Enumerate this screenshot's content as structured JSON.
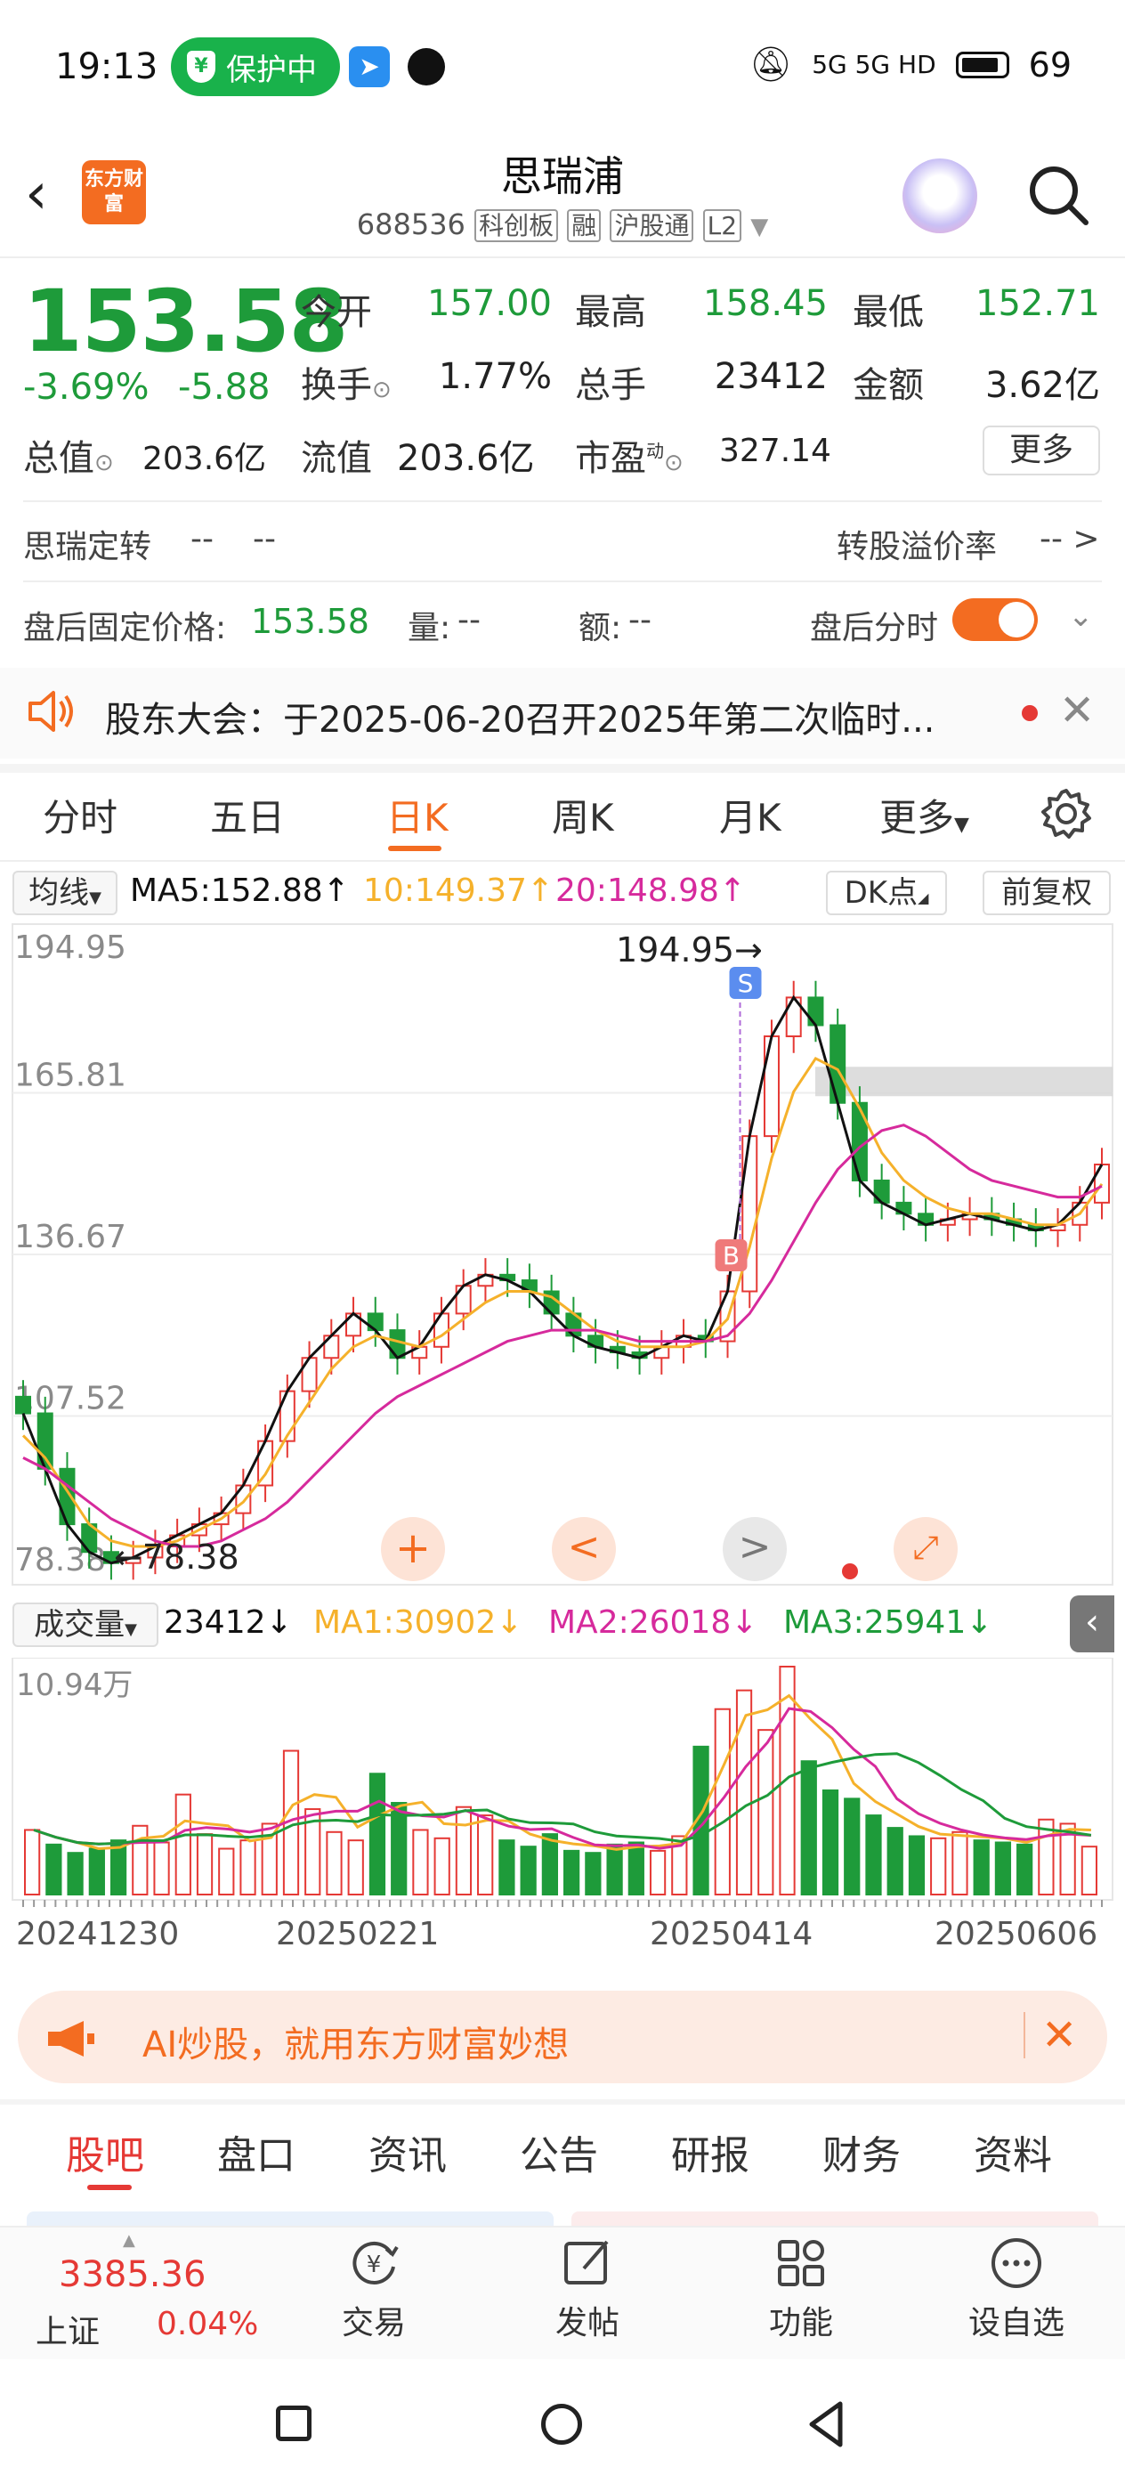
{
  "status_bar": {
    "time": "19:13",
    "protect_label": "保护中",
    "battery": "69",
    "network": "5G 5G HD"
  },
  "header": {
    "logo": "东方财富",
    "title": "思瑞浦",
    "code": "688536",
    "tags": [
      "科创板",
      "融",
      "沪股通",
      "L2"
    ]
  },
  "quote": {
    "price": "153.58",
    "change_pct": "-3.69%",
    "change_abs": "-5.88",
    "open_label": "今开",
    "open": "157.00",
    "high_label": "最高",
    "high": "158.45",
    "low_label": "最低",
    "low": "152.71",
    "turnover_label": "换手",
    "turnover": "1.77%",
    "volume_label": "总手",
    "volume": "23412",
    "amount_label": "金额",
    "amount": "3.62亿",
    "mktcap_label": "总值",
    "mktcap": "203.6亿",
    "float_label": "流值",
    "float": "203.6亿",
    "pe_label": "市盈",
    "pe_sup": "动",
    "pe": "327.14",
    "more": "更多"
  },
  "convertible": {
    "name": "思瑞定转",
    "v1": "--",
    "v2": "--",
    "premium_label": "转股溢价率",
    "premium": "-- >"
  },
  "after_hours": {
    "fixed_label": "盘后固定价格:",
    "fixed": "153.58",
    "vol_label": "量:",
    "vol": "--",
    "amt_label": "额:",
    "amt": "--",
    "timeshare_label": "盘后分时"
  },
  "notice": {
    "text": "股东大会：于2025-06-20召开2025年第二次临时..."
  },
  "period_tabs": [
    "分时",
    "五日",
    "日K",
    "周K",
    "月K",
    "更多"
  ],
  "ma": {
    "select": "均线",
    "ma5": "MA5:152.88↑",
    "ma10": "10:149.37↑",
    "ma20": "20:148.98↑",
    "dk": "DK点",
    "adjust": "前复权"
  },
  "colors": {
    "up": "#e53935",
    "down": "#1e9b3a",
    "ma5": "#111111",
    "ma10": "#f5b12b",
    "ma20": "#d62a9c",
    "accent": "#f36c21"
  },
  "chart_data": [
    {
      "type": "candlestick",
      "y_axis_ticks": [
        "194.95",
        "165.81",
        "136.67",
        "107.52",
        "78.38"
      ],
      "ylim": [
        78.38,
        194.95
      ],
      "max_label": "194.95→",
      "min_label": "←78.38",
      "x_ticks": [
        "20241230",
        "20250221",
        "20250414",
        "20250606"
      ],
      "series": [
        {
          "name": "MA5",
          "values": [
            108,
            98,
            88,
            83,
            81,
            82,
            84,
            86,
            88,
            90,
            95,
            103,
            112,
            118,
            122,
            126,
            123,
            118,
            120,
            126,
            131,
            133,
            132,
            130,
            126,
            122,
            120,
            119,
            118,
            120,
            122,
            121,
            130,
            158,
            176,
            183,
            178,
            164,
            150,
            146,
            144,
            142,
            143,
            144,
            143,
            142,
            141,
            142,
            146,
            152.88
          ]
        },
        {
          "name": "MA10",
          "values": [
            104,
            100,
            94,
            88,
            85,
            84,
            84,
            85,
            87,
            89,
            92,
            97,
            104,
            110,
            116,
            120,
            122,
            121,
            120,
            122,
            125,
            128,
            130,
            130,
            129,
            126,
            123,
            121,
            120,
            120,
            120,
            121,
            125,
            138,
            154,
            166,
            172,
            170,
            163,
            155,
            150,
            147,
            145,
            144,
            144,
            143,
            142,
            142,
            144,
            149.37
          ]
        },
        {
          "name": "MA20",
          "values": [
            100,
            98,
            95,
            92,
            89,
            87,
            85,
            84,
            84,
            85,
            87,
            89,
            92,
            96,
            100,
            104,
            108,
            111,
            113,
            115,
            117,
            119,
            121,
            122,
            123,
            123,
            123,
            122,
            121,
            121,
            121,
            121,
            122,
            126,
            132,
            139,
            146,
            152,
            156,
            159,
            160,
            158,
            155,
            152,
            150,
            149,
            148,
            147,
            147,
            148.98
          ]
        }
      ]
    },
    {
      "type": "bar",
      "title": "成交量",
      "latest": "23412↓",
      "max_label": "10.94万",
      "legend": [
        "MA1:30902↓",
        "MA2:26018↓",
        "MA3:25941↓"
      ],
      "values": [
        3.1,
        2.4,
        2.0,
        2.2,
        2.6,
        3.3,
        2.5,
        4.8,
        2.9,
        2.2,
        2.6,
        3.4,
        6.9,
        4.1,
        3.0,
        2.6,
        5.8,
        4.4,
        3.1,
        2.7,
        4.2,
        3.8,
        2.6,
        2.3,
        2.9,
        2.1,
        2.0,
        2.4,
        2.5,
        2.1,
        2.8,
        7.1,
        8.9,
        9.8,
        7.9,
        10.94,
        6.4,
        5.0,
        4.6,
        3.8,
        3.2,
        2.8,
        2.7,
        3.0,
        2.6,
        2.5,
        2.4,
        3.6,
        3.4,
        2.3
      ]
    }
  ],
  "ad": {
    "text": "AI炒股，就用东方财富妙想"
  },
  "bottom_tabs": [
    "股吧",
    "盘口",
    "资讯",
    "公告",
    "研报",
    "财务",
    "资料"
  ],
  "index": {
    "value": "3385.36",
    "name": "上证",
    "change": "0.04%"
  },
  "bottom_nav": [
    "交易",
    "发帖",
    "功能",
    "设自选"
  ]
}
